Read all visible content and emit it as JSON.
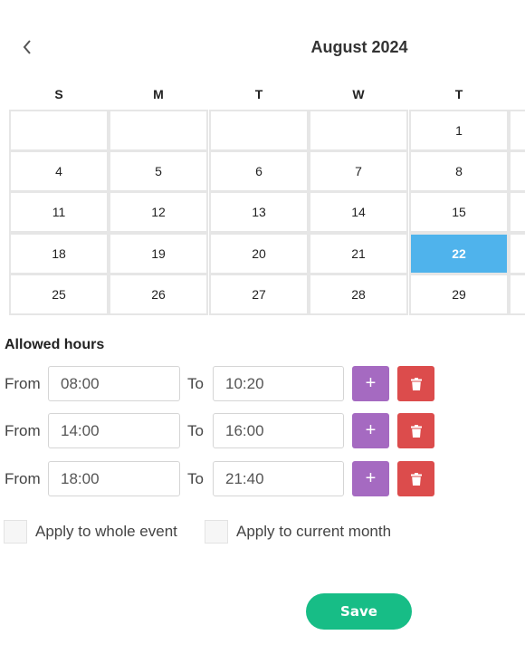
{
  "calendar": {
    "prev_icon": "chevron-left-icon",
    "month_title": "August 2024",
    "weekdays": [
      "S",
      "M",
      "T",
      "W",
      "T"
    ],
    "weeks": [
      [
        "",
        "",
        "",
        "",
        "1"
      ],
      [
        "4",
        "5",
        "6",
        "7",
        "8"
      ],
      [
        "11",
        "12",
        "13",
        "14",
        "15"
      ],
      [
        "18",
        "19",
        "20",
        "21",
        "22"
      ],
      [
        "25",
        "26",
        "27",
        "28",
        "29"
      ]
    ],
    "selected_day": "22",
    "selected_color": "#4fb3ec"
  },
  "allowed_hours": {
    "title": "Allowed hours",
    "from_label": "From",
    "to_label": "To",
    "add_label": "+",
    "delete_icon": "trash-icon",
    "rows": [
      {
        "from": "08:00",
        "to": "10:20"
      },
      {
        "from": "14:00",
        "to": "16:00"
      },
      {
        "from": "18:00",
        "to": "21:40"
      }
    ],
    "add_color": "#a56ac1",
    "delete_color": "#dc4c4c"
  },
  "options": {
    "whole_event_label": "Apply to whole event",
    "current_month_label": "Apply to current month"
  },
  "actions": {
    "save_label": "Save",
    "save_color": "#17bd86"
  }
}
